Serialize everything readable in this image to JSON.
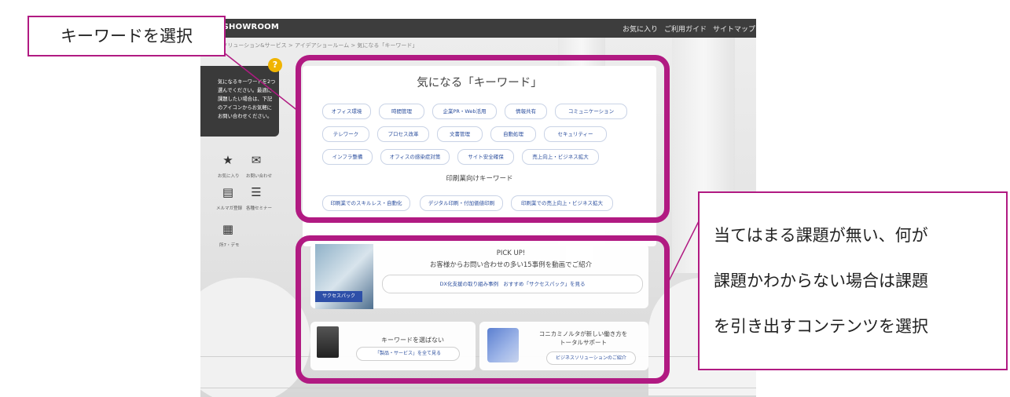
{
  "header": {
    "brand": "EA SHOWROOM",
    "links": [
      "お気に入り",
      "ご利用ガイド",
      "サイトマップ"
    ]
  },
  "breadcrumb": "ム > ソリューション&サービス > アイデアショールーム > 気になる「キーワード」",
  "help_panel": {
    "badge": "?",
    "text": "気になるキーワードを2つ選んでください。最適に課題したい場合は、下記のアイコンからお気軽にお問い合わせください。"
  },
  "side_menu": [
    {
      "label": "お気に入り",
      "icon": "star-icon"
    },
    {
      "label": "お問い合わせ",
      "icon": "mail-icon"
    },
    {
      "label": "メルマガ登録",
      "icon": "newsletter-icon"
    },
    {
      "label": "各種セミナー",
      "icon": "seminar-icon"
    },
    {
      "label": "所7・デモ",
      "icon": "building-icon"
    }
  ],
  "keywords": {
    "title": "気になる「キーワード」",
    "rows": [
      [
        "オフィス環境",
        "時間管理",
        "企業PR・Web活用",
        "情報共有",
        "コミュニケーション"
      ],
      [
        "テレワーク",
        "プロセス改革",
        "文書管理",
        "自動処理",
        "セキュリティー"
      ],
      [
        "インフラ整備",
        "オフィスの感染症対策",
        "サイト安全確保",
        "売上向上・ビジネス拡大"
      ]
    ],
    "print_title": "印刷業向けキーワード",
    "print_row": [
      "印刷業でのスキルレス・自動化",
      "デジタル印刷・付加価値印刷",
      "印刷業での売上向上・ビジネス拡大"
    ]
  },
  "pickup": {
    "heading": "PICK UP!",
    "subtitle": "お客様からお問い合わせの多い15事例を動画でご紹介",
    "button": "DX化支援の取り組み事例　おすすめ「サクセスパック」を見る",
    "image_tag": "サクセスパック"
  },
  "cards": [
    {
      "title": "キーワードを選ばない",
      "button": "「製品・サービス」を全て見る"
    },
    {
      "title": "コニカミノルタが新しい働き方をトータルサポート",
      "title_line1": "コニカミノルタが新しい働き方を",
      "title_line2": "トータルサポート",
      "button": "ビジネスソリューションのご紹介"
    }
  ],
  "annotations": {
    "left_callout": "キーワードを選択",
    "right_callout_lines": [
      "当てはまる課題が無い、何が",
      "課題かわからない場合は課題",
      "を引き出すコンテンツを選択"
    ],
    "frame_color": "#b11a82"
  }
}
